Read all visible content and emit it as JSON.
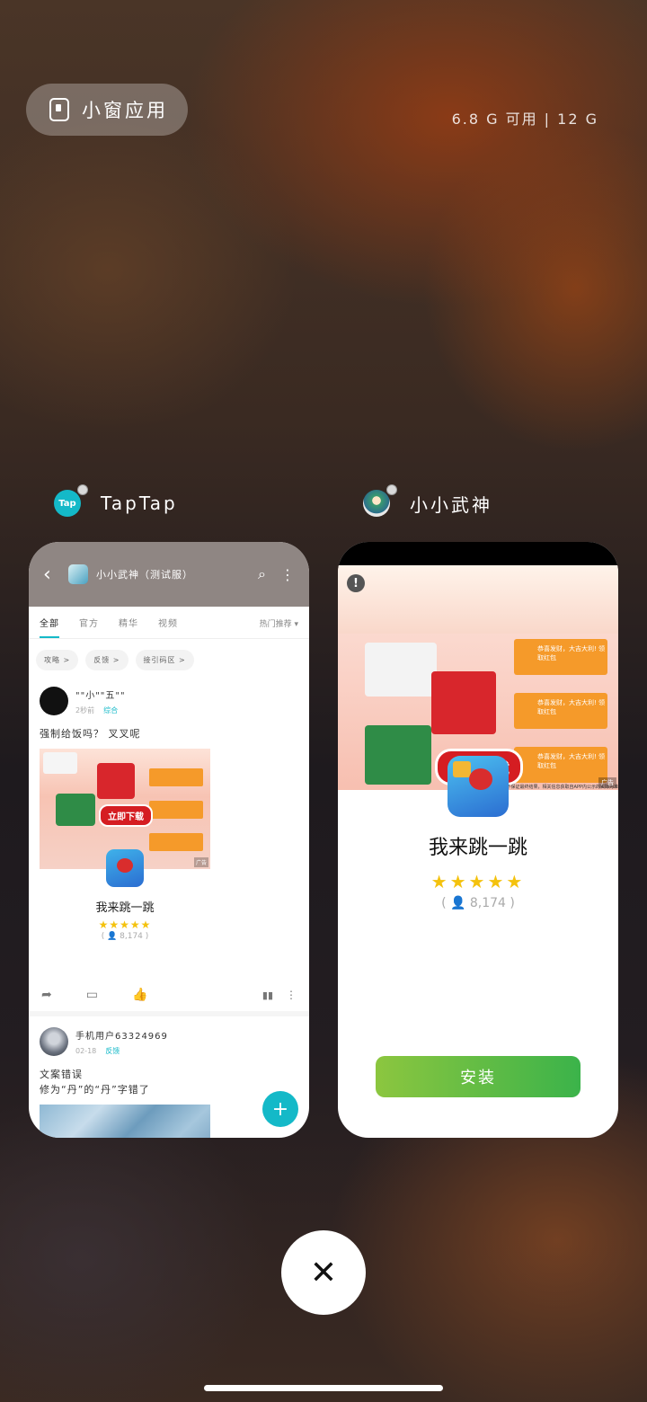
{
  "top": {
    "floating_label": "小窗应用",
    "memory": "6.8 G 可用 | 12 G"
  },
  "apps": {
    "left": {
      "name": "TapTap",
      "header": {
        "back": "‹",
        "title": "小小武神（测试服）",
        "search": "⌕",
        "more": "⋮"
      },
      "tabs": [
        "全部",
        "官方",
        "精华",
        "视频"
      ],
      "sort": "热门推荐 ▾",
      "chips": [
        "攻略 >",
        "反馈 >",
        "接引码区 >"
      ],
      "post1": {
        "user": "\"\"小\"\"五\"\"",
        "time": "2秒前",
        "tag": "综合",
        "text": "强制给饭吗？ 叉叉呢",
        "ad_button": "立即下载",
        "ad_mark": "广告",
        "game_name": "我来跳一跳",
        "stars": "★★★★★",
        "rating": "( 👤 8,174 )"
      },
      "post2": {
        "user": "手机用户63324969",
        "time": "02-18",
        "tag": "反馈",
        "text_line1": "文案错误",
        "text_line2": "修为“丹”的“丹”字错了"
      },
      "fab": "+"
    },
    "right": {
      "name": "小小武神",
      "warning": "!",
      "ad_button": "立即下载",
      "red_packet_text": "恭喜发财，大吉大利! 领取红包",
      "fine_print": "不保证最终结果，相关信息获取自APP内公示的实际为准",
      "ad_mark": "广告",
      "game_name": "我来跳一跳",
      "stars": "★★★★★",
      "rating": "( 👤 8,174 )",
      "install": "安装"
    }
  },
  "close": "✕"
}
